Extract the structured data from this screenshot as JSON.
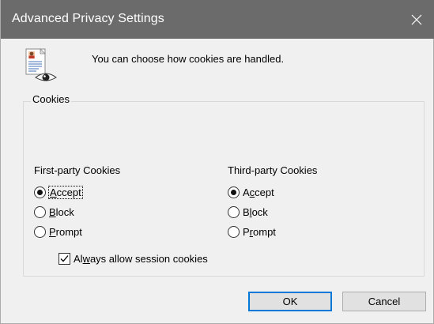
{
  "window": {
    "title": "Advanced Privacy Settings",
    "close_icon": "close-icon"
  },
  "header": {
    "icon": "privacy-document-eye-icon",
    "text": "You can choose how cookies are handled."
  },
  "cookies_group": {
    "legend": "Cookies",
    "first_party": {
      "label": "First-party Cookies",
      "options": [
        {
          "pre": "",
          "accel": "A",
          "post": "ccept",
          "checked": true
        },
        {
          "pre": "",
          "accel": "B",
          "post": "lock",
          "checked": false
        },
        {
          "pre": "",
          "accel": "P",
          "post": "rompt",
          "checked": false
        }
      ]
    },
    "third_party": {
      "label": "Third-party Cookies",
      "options": [
        {
          "pre": "A",
          "accel": "c",
          "post": "cept",
          "checked": true
        },
        {
          "pre": "B",
          "accel": "l",
          "post": "ock",
          "checked": false
        },
        {
          "pre": "P",
          "accel": "r",
          "post": "ompt",
          "checked": false
        }
      ]
    },
    "session": {
      "pre": "Al",
      "accel": "w",
      "post": "ays allow session cookies",
      "checked": true
    }
  },
  "buttons": {
    "ok": "OK",
    "cancel": "Cancel"
  }
}
